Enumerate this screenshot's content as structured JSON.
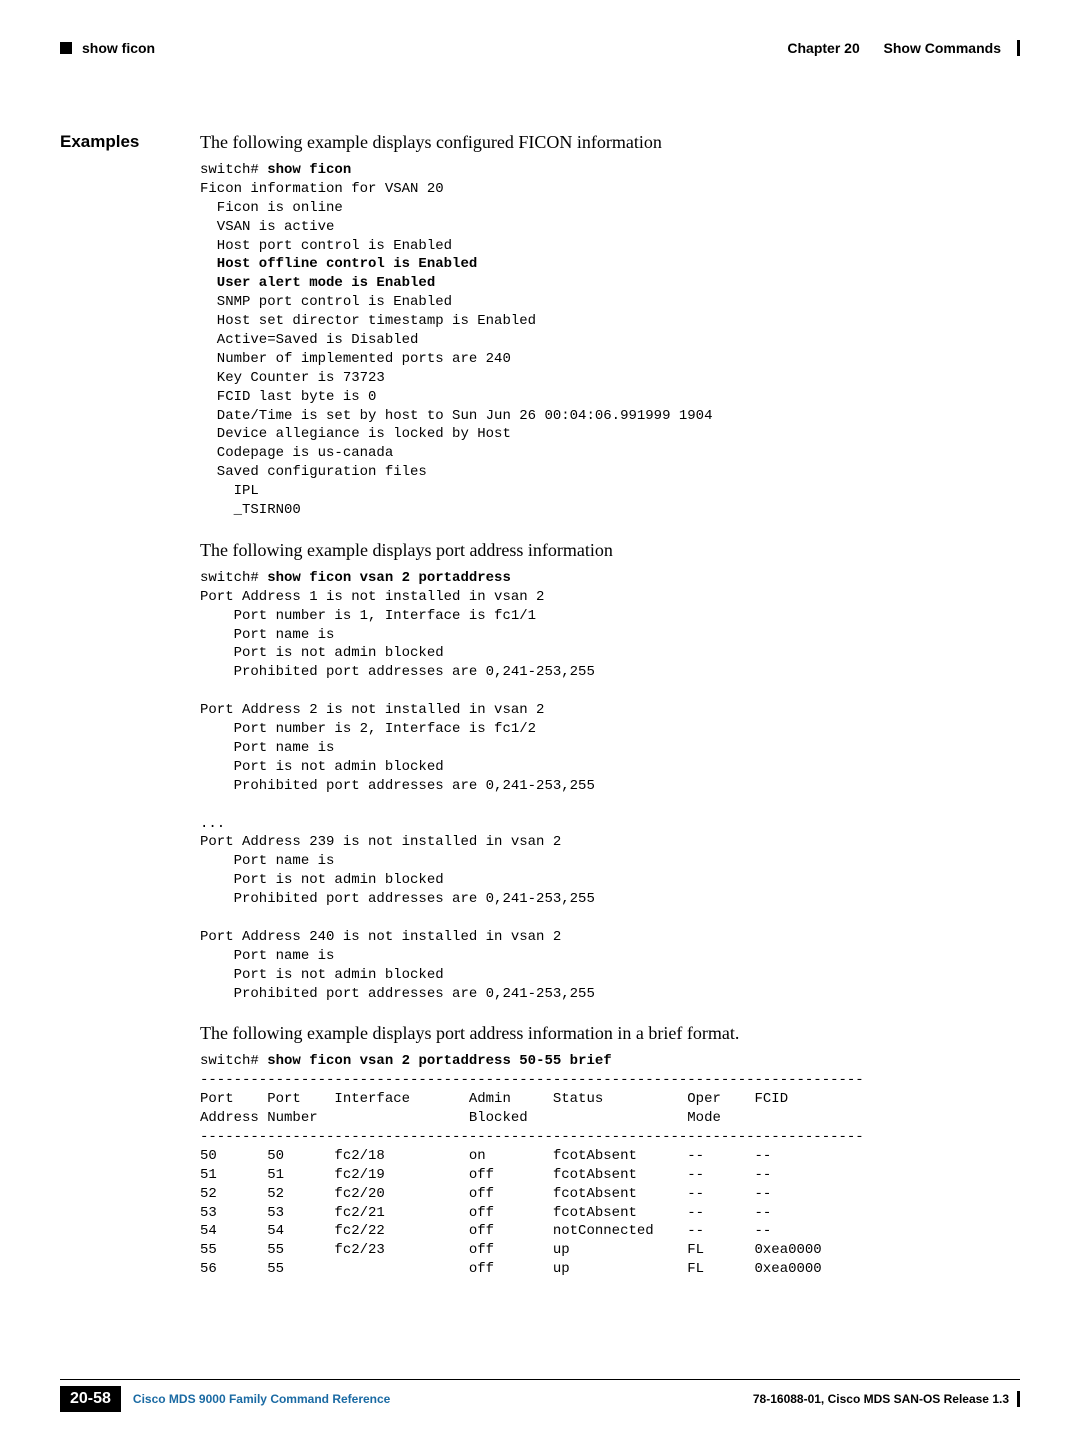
{
  "header": {
    "left_label": "show ficon",
    "chapter": "Chapter 20",
    "chapter_title": "Show Commands"
  },
  "section": {
    "label": "Examples",
    "intro1": "The following example displays configured FICON information",
    "intro2": "The following example displays port address information",
    "intro3": "The following example displays port address information in a brief format."
  },
  "code1": {
    "prompt": "switch# ",
    "cmd": "show ficon",
    "l1": "Ficon information for VSAN 20",
    "l2": "  Ficon is online",
    "l3": "  VSAN is active",
    "l4": "  Host port control is Enabled",
    "b1": "  Host offline control is Enabled",
    "b2": "  User alert mode is Enabled",
    "l5": "  SNMP port control is Enabled",
    "l6": "  Host set director timestamp is Enabled",
    "l7": "  Active=Saved is Disabled",
    "l8": "  Number of implemented ports are 240",
    "l9": "  Key Counter is 73723",
    "l10": "  FCID last byte is 0",
    "l11": "  Date/Time is set by host to Sun Jun 26 00:04:06.991999 1904",
    "l12": "  Device allegiance is locked by Host",
    "l13": "  Codepage is us-canada",
    "l14": "  Saved configuration files",
    "l15": "    IPL",
    "l16": "    _TSIRN00"
  },
  "code2": {
    "prompt": "switch# ",
    "cmd": "show ficon vsan 2 portaddress",
    "body": "Port Address 1 is not installed in vsan 2\n    Port number is 1, Interface is fc1/1\n    Port name is\n    Port is not admin blocked\n    Prohibited port addresses are 0,241-253,255\n\nPort Address 2 is not installed in vsan 2\n    Port number is 2, Interface is fc1/2\n    Port name is\n    Port is not admin blocked\n    Prohibited port addresses are 0,241-253,255\n\n...\nPort Address 239 is not installed in vsan 2\n    Port name is\n    Port is not admin blocked\n    Prohibited port addresses are 0,241-253,255\n\nPort Address 240 is not installed in vsan 2\n    Port name is\n    Port is not admin blocked\n    Prohibited port addresses are 0,241-253,255"
  },
  "code3": {
    "prompt": "switch# ",
    "cmd": "show ficon vsan 2 portaddress 50-55 brief",
    "body": "-------------------------------------------------------------------------------\nPort    Port    Interface       Admin     Status          Oper    FCID\nAddress Number                  Blocked                   Mode\n-------------------------------------------------------------------------------\n50      50      fc2/18          on        fcotAbsent      --      --\n51      51      fc2/19          off       fcotAbsent      --      --\n52      52      fc2/20          off       fcotAbsent      --      --\n53      53      fc2/21          off       fcotAbsent      --      --\n54      54      fc2/22          off       notConnected    --      --\n55      55      fc2/23          off       up              FL      0xea0000\n56      55                      off       up              FL      0xea0000"
  },
  "footer": {
    "page_num": "20-58",
    "title": "Cisco MDS 9000 Family Command Reference",
    "release": "78-16088-01, Cisco MDS SAN-OS Release 1.3"
  }
}
